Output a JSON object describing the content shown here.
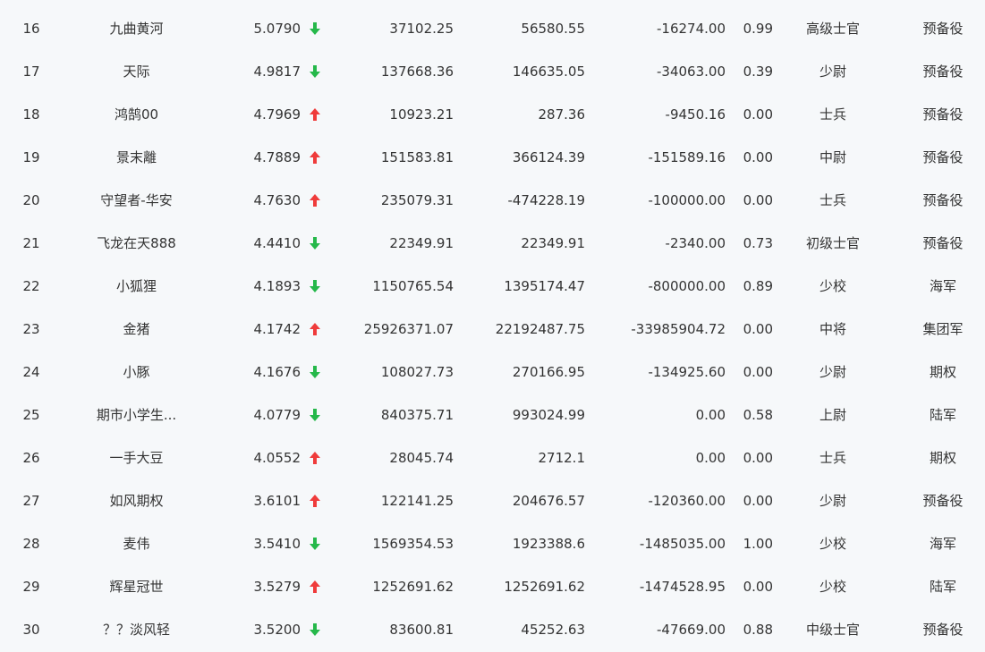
{
  "colors": {
    "up": "#ef3b3b",
    "down": "#25b84a",
    "text": "#333333",
    "background": "#f6f8fa"
  },
  "rows": [
    {
      "rank": "16",
      "name": "九曲黄河",
      "score": "5.0790",
      "trend": "down",
      "col_a": "37102.25",
      "col_b": "56580.55",
      "col_c": "-16274.00",
      "col_d": "0.99",
      "rank_name": "高级士官",
      "group": "预备役"
    },
    {
      "rank": "17",
      "name": "天际",
      "score": "4.9817",
      "trend": "down",
      "col_a": "137668.36",
      "col_b": "146635.05",
      "col_c": "-34063.00",
      "col_d": "0.39",
      "rank_name": "少尉",
      "group": "预备役"
    },
    {
      "rank": "18",
      "name": "鸿鹄00",
      "score": "4.7969",
      "trend": "up",
      "col_a": "10923.21",
      "col_b": "287.36",
      "col_c": "-9450.16",
      "col_d": "0.00",
      "rank_name": "士兵",
      "group": "预备役"
    },
    {
      "rank": "19",
      "name": "景末離",
      "score": "4.7889",
      "trend": "up",
      "col_a": "151583.81",
      "col_b": "366124.39",
      "col_c": "-151589.16",
      "col_d": "0.00",
      "rank_name": "中尉",
      "group": "预备役"
    },
    {
      "rank": "20",
      "name": "守望者-华安",
      "score": "4.7630",
      "trend": "up",
      "col_a": "235079.31",
      "col_b": "-474228.19",
      "col_c": "-100000.00",
      "col_d": "0.00",
      "rank_name": "士兵",
      "group": "预备役"
    },
    {
      "rank": "21",
      "name": "飞龙在天888",
      "score": "4.4410",
      "trend": "down",
      "col_a": "22349.91",
      "col_b": "22349.91",
      "col_c": "-2340.00",
      "col_d": "0.73",
      "rank_name": "初级士官",
      "group": "预备役"
    },
    {
      "rank": "22",
      "name": "小狐狸",
      "score": "4.1893",
      "trend": "down",
      "col_a": "1150765.54",
      "col_b": "1395174.47",
      "col_c": "-800000.00",
      "col_d": "0.89",
      "rank_name": "少校",
      "group": "海军"
    },
    {
      "rank": "23",
      "name": "金猪",
      "score": "4.1742",
      "trend": "up",
      "col_a": "25926371.07",
      "col_b": "22192487.75",
      "col_c": "-33985904.72",
      "col_d": "0.00",
      "rank_name": "中将",
      "group": "集团军"
    },
    {
      "rank": "24",
      "name": "小豚",
      "score": "4.1676",
      "trend": "down",
      "col_a": "108027.73",
      "col_b": "270166.95",
      "col_c": "-134925.60",
      "col_d": "0.00",
      "rank_name": "少尉",
      "group": "期权"
    },
    {
      "rank": "25",
      "name": "期市小学生...",
      "score": "4.0779",
      "trend": "down",
      "col_a": "840375.71",
      "col_b": "993024.99",
      "col_c": "0.00",
      "col_d": "0.58",
      "rank_name": "上尉",
      "group": "陆军"
    },
    {
      "rank": "26",
      "name": "一手大豆",
      "score": "4.0552",
      "trend": "up",
      "col_a": "28045.74",
      "col_b": "2712.1",
      "col_c": "0.00",
      "col_d": "0.00",
      "rank_name": "士兵",
      "group": "期权"
    },
    {
      "rank": "27",
      "name": "如风期权",
      "score": "3.6101",
      "trend": "up",
      "col_a": "122141.25",
      "col_b": "204676.57",
      "col_c": "-120360.00",
      "col_d": "0.00",
      "rank_name": "少尉",
      "group": "预备役"
    },
    {
      "rank": "28",
      "name": "麦伟",
      "score": "3.5410",
      "trend": "down",
      "col_a": "1569354.53",
      "col_b": "1923388.6",
      "col_c": "-1485035.00",
      "col_d": "1.00",
      "rank_name": "少校",
      "group": "海军"
    },
    {
      "rank": "29",
      "name": "辉星冠世",
      "score": "3.5279",
      "trend": "up",
      "col_a": "1252691.62",
      "col_b": "1252691.62",
      "col_c": "-1474528.95",
      "col_d": "0.00",
      "rank_name": "少校",
      "group": "陆军"
    },
    {
      "rank": "30",
      "name": "？？淡风轻",
      "score": "3.5200",
      "trend": "down",
      "col_a": "83600.81",
      "col_b": "45252.63",
      "col_c": "-47669.00",
      "col_d": "0.88",
      "rank_name": "中级士官",
      "group": "预备役"
    }
  ]
}
